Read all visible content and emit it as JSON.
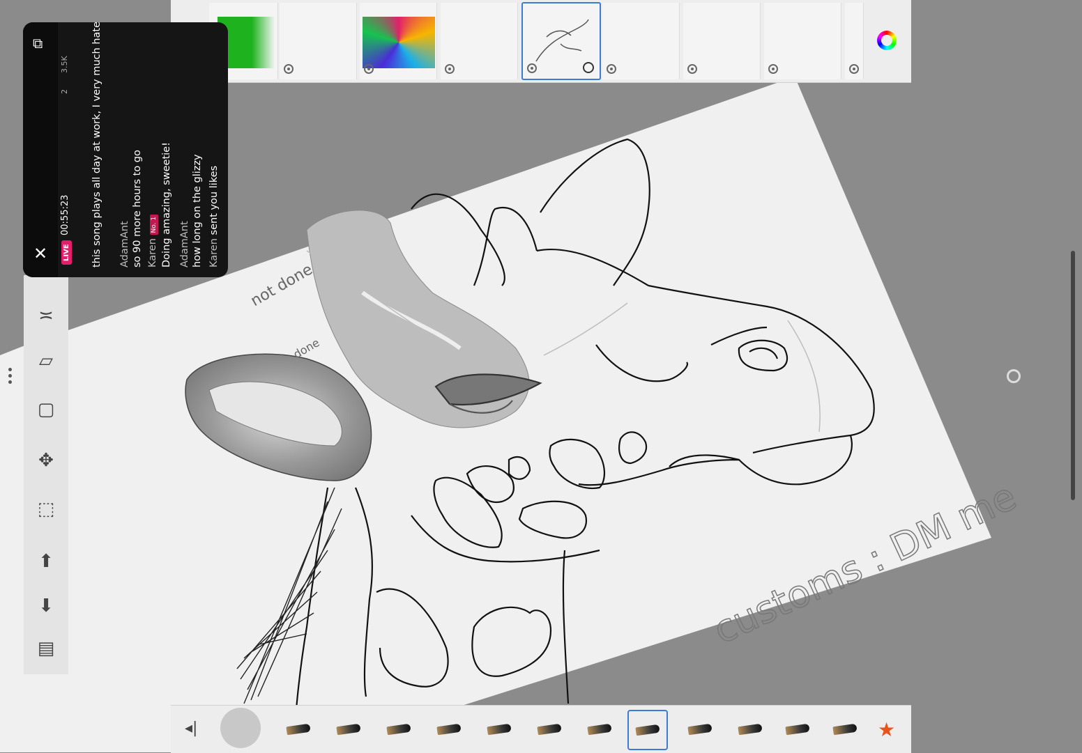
{
  "live": {
    "badge": "LIVE",
    "timer": "00:55:23",
    "viewers": "2",
    "likes": "3.5K",
    "chat": [
      {
        "user": "",
        "text": "this song plays all day at work, I very much hate it"
      },
      {
        "user": "AdamAnt",
        "text": "so 90 more hours to go"
      },
      {
        "user": "Karen",
        "text": "Doing amazing, sweetie!",
        "tag": "No. 1"
      },
      {
        "user": "AdamAnt",
        "text": "how long on the glizzy"
      },
      {
        "user": "Karen",
        "text": "sent you likes"
      }
    ]
  },
  "canvas": {
    "annotation_1": "not done",
    "annotation_2": "done",
    "signature": "customs : DM me"
  },
  "icons": {
    "color_picker": "color-wheel-icon",
    "close": "close-icon"
  },
  "colors": {
    "accent": "#3a7bd5",
    "live": "#e0206a",
    "toolbar": "#ededed",
    "background": "#8b8b8b"
  }
}
